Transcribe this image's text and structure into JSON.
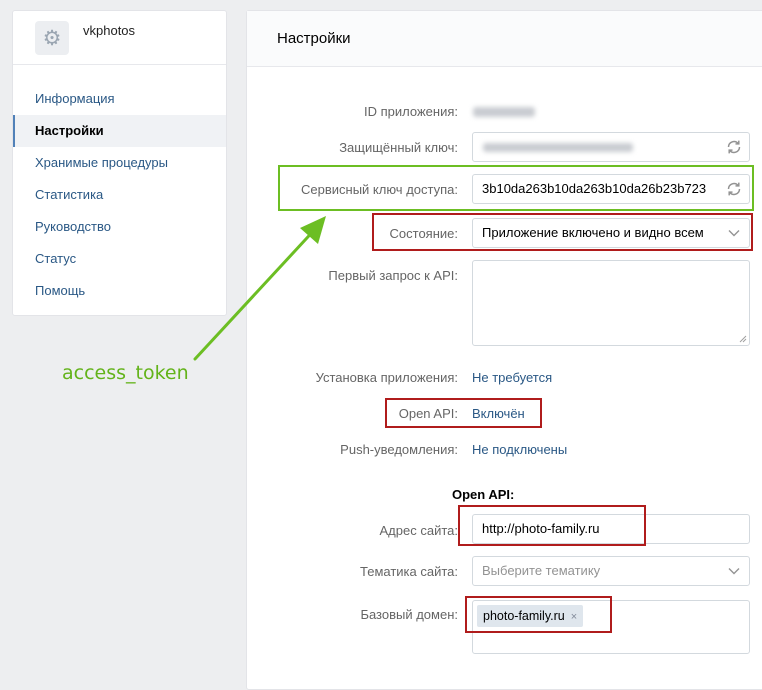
{
  "app": {
    "name": "vkphotos",
    "icon": "gear-icon"
  },
  "sidebar": {
    "items": [
      {
        "label": "Информация",
        "active": false
      },
      {
        "label": "Настройки",
        "active": true
      },
      {
        "label": "Хранимые процедуры",
        "active": false
      },
      {
        "label": "Статистика",
        "active": false
      },
      {
        "label": "Руководство",
        "active": false
      },
      {
        "label": "Статус",
        "active": false
      },
      {
        "label": "Помощь",
        "active": false
      }
    ]
  },
  "page": {
    "title": "Настройки"
  },
  "settings": {
    "app_id": {
      "label": "ID приложения:",
      "value_hidden": true
    },
    "secure_key": {
      "label": "Защищённый ключ:",
      "value_hidden": true,
      "icon": "refresh-icon"
    },
    "service_key": {
      "label": "Сервисный ключ доступа:",
      "value": "3b10da263b10da263b10da26b23b723",
      "icon": "refresh-icon"
    },
    "state": {
      "label": "Состояние:",
      "value": "Приложение включено и видно всем",
      "icon": "chevron-down-icon"
    },
    "first_api_request": {
      "label": "Первый запрос к API:",
      "value": ""
    },
    "install": {
      "label": "Установка приложения:",
      "value": "Не требуется"
    },
    "open_api": {
      "label": "Open API:",
      "value": "Включён"
    },
    "push": {
      "label": "Push-уведомления:",
      "value": "Не подключены"
    }
  },
  "open_api_section": {
    "title": "Open API:",
    "site_address": {
      "label": "Адрес сайта:",
      "value": "http://photo-family.ru"
    },
    "site_topic": {
      "label": "Тематика сайта:",
      "placeholder": "Выберите тематику",
      "icon": "chevron-down-icon"
    },
    "base_domain": {
      "label": "Базовый домен:",
      "tags": [
        "photo-family.ru"
      ],
      "tag_close": "×"
    }
  },
  "annotation": {
    "label": "access_token",
    "color": "#63b31a",
    "highlight_color": "#b01c1c"
  }
}
